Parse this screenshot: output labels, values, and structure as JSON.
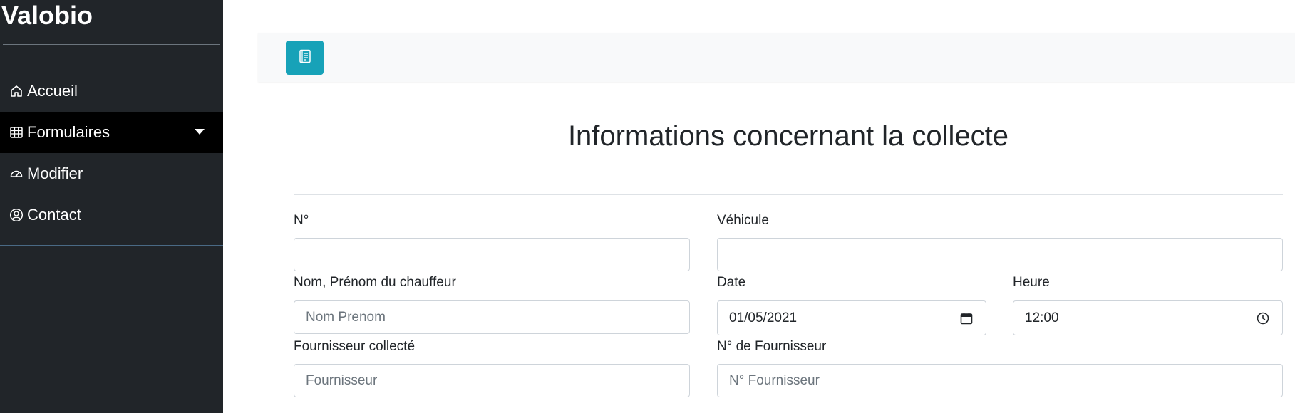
{
  "sidebar": {
    "brand": "Valobio",
    "items": [
      {
        "label": "Accueil",
        "icon": "home-icon"
      },
      {
        "label": "Formulaires",
        "icon": "table-icon",
        "active": true
      },
      {
        "label": "Modifier",
        "icon": "speedometer-icon"
      },
      {
        "label": "Contact",
        "icon": "person-circle-icon"
      }
    ]
  },
  "topbar": {
    "toggle_icon": "journal-icon",
    "accent": "#17a2b8"
  },
  "main": {
    "title": "Informations concernant la collecte",
    "fields": {
      "numero": {
        "label": "N°",
        "value": "",
        "placeholder": ""
      },
      "vehicule": {
        "label": "Véhicule",
        "value": "",
        "placeholder": ""
      },
      "chauffeur": {
        "label": "Nom, Prénom du chauffeur",
        "value": "",
        "placeholder": "Nom Prenom"
      },
      "date": {
        "label": "Date",
        "value": "01/05/2021",
        "icon": "calendar-icon"
      },
      "heure": {
        "label": "Heure",
        "value": "12:00",
        "icon": "clock-icon"
      },
      "fournisseur": {
        "label": "Fournisseur collecté",
        "value": "",
        "placeholder": "Fournisseur"
      },
      "num_fournisseur": {
        "label": "N° de Fournisseur",
        "value": "",
        "placeholder": "N° Fournisseur"
      }
    }
  },
  "colors": {
    "sidebar_bg": "#212529",
    "active_bg": "#000000",
    "topbar_bg": "#f8f9fa"
  }
}
